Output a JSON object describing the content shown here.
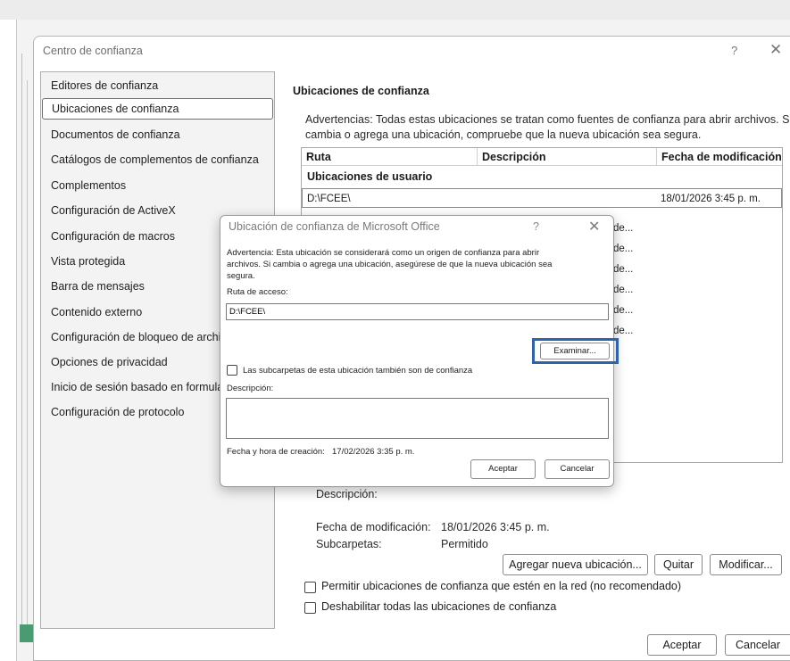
{
  "main_dialog": {
    "title": "Centro de confianza",
    "help_glyph": "?",
    "close_glyph": "✕"
  },
  "nav": {
    "items": [
      "Editores de confianza",
      "Ubicaciones de confianza",
      "Documentos de confianza",
      "Catálogos de complementos de confianza",
      "Complementos",
      "Configuración de ActiveX",
      "Configuración de macros",
      "Vista protegida",
      "Barra de mensajes",
      "Contenido externo",
      "Configuración de bloqueo de archivos",
      "Opciones de privacidad",
      "Inicio de sesión basado en formularios",
      "Configuración de protocolo"
    ],
    "selected_index": 1
  },
  "locations": {
    "title": "Ubicaciones de confianza",
    "warning_line1": "Advertencias: Todas estas ubicaciones se tratan como fuentes de confianza para abrir archivos. Si",
    "warning_line2": "cambia o agrega una ubicación, compruebe que la nueva ubicación sea segura.",
    "columns": [
      "Ruta",
      "Descripción",
      "Fecha de modificación"
    ],
    "group_label": "Ubicaciones de usuario",
    "rows": [
      {
        "path": "D:\\FCEE\\",
        "date": "18/01/2026 3:45 p. m."
      }
    ],
    "partial_cells": [
      "de...",
      "de...",
      "de...",
      "de...",
      "de...",
      "de..."
    ]
  },
  "details": {
    "description_label": "Descripción:",
    "modified_label": "Fecha de modificación:",
    "modified_value": "18/01/2026 3:45 p. m.",
    "subfolders_label": "Subcarpetas:",
    "subfolders_value": "Permitido"
  },
  "buttons": {
    "add": "Agregar nueva ubicación...",
    "remove": "Quitar",
    "modify": "Modificar...",
    "ok": "Aceptar",
    "cancel": "Cancelar"
  },
  "checkboxes": {
    "network": "Permitir ubicaciones de confianza que estén en la red (no recomendado)",
    "disable_all": "Deshabilitar todas las ubicaciones de confianza"
  },
  "modal": {
    "title": "Ubicación de confianza de Microsoft Office",
    "help_glyph": "?",
    "close_glyph": "✕",
    "warning_line1": "Advertencia: Esta ubicación se considerará como un origen de confianza para abrir",
    "warning_line2": "archivos. Si cambia o agrega una ubicación, asegúrese de que la nueva ubicación sea",
    "warning_line3": "segura.",
    "path_label": "Ruta de acceso:",
    "path_value": "D:\\FCEE\\",
    "browse": "Examinar...",
    "subfolders_checkbox": "Las subcarpetas de esta ubicación también son de confianza",
    "description_label": "Descripción:",
    "created_label": "Fecha y hora de creación:",
    "created_value": "17/02/2026 3:35 p. m.",
    "ok": "Aceptar",
    "cancel": "Cancelar"
  },
  "colors": {
    "highlight_border": "#2f63ad"
  }
}
